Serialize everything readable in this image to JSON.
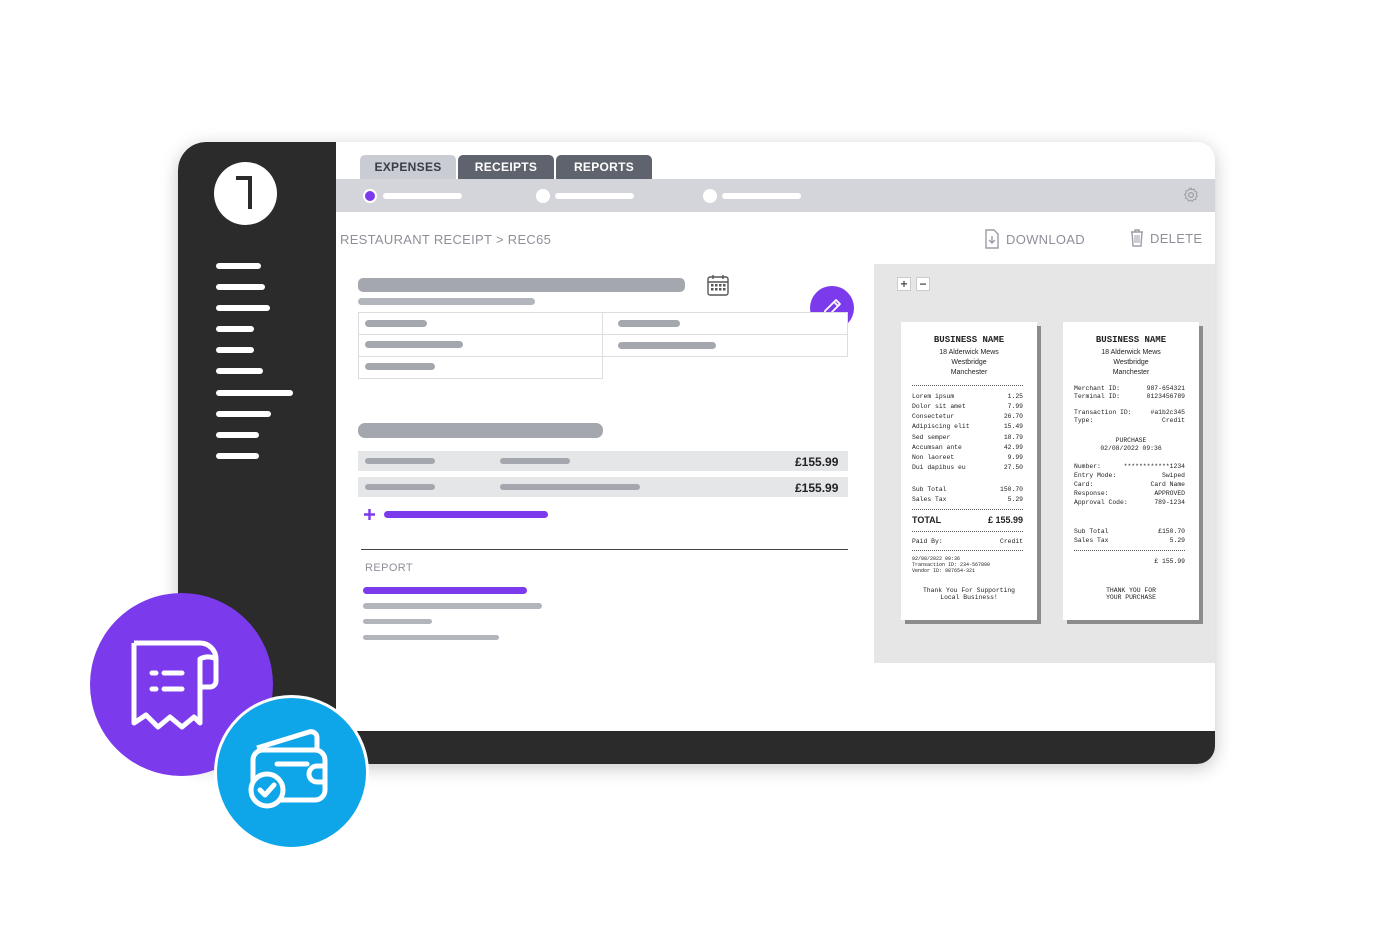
{
  "tabs": [
    {
      "label": "EXPENSES",
      "active": true
    },
    {
      "label": "RECEIPTS",
      "active": false
    },
    {
      "label": "REPORTS",
      "active": false
    }
  ],
  "breadcrumb": "RESTAURANT RECEIPT > REC65",
  "actions": {
    "download": "DOWNLOAD",
    "delete": "DELETE"
  },
  "line_items": [
    {
      "amount": "£155.99"
    },
    {
      "amount": "£155.99"
    }
  ],
  "report": {
    "label": "REPORT"
  },
  "colors": {
    "accent": "#7c3aed",
    "secondary": "#0ea5e9",
    "dark": "#2b2b2b"
  },
  "icons": [
    "calendar-icon",
    "pencil-icon",
    "download-icon",
    "trash-icon",
    "gear-icon",
    "plus-icon",
    "minus-icon",
    "receipt-icon",
    "wallet-icon"
  ],
  "receipt_left": {
    "title": "BUSINESS NAME",
    "address": [
      "18 Alderwick Mews",
      "Westbridge",
      "Manchester"
    ],
    "items": [
      {
        "name": "Lorem ipsum",
        "price": "1.25"
      },
      {
        "name": "Dolor sit amet",
        "price": "7.99"
      },
      {
        "name": "Consectetur",
        "price": "26.70"
      },
      {
        "name": "Adipiscing elit",
        "price": "15.49"
      },
      {
        "name": "Sed semper",
        "price": "18.79"
      },
      {
        "name": "Accumsan ante",
        "price": "42.99"
      },
      {
        "name": "Non laoreet",
        "price": "9.99"
      },
      {
        "name": "Dui dapibus eu",
        "price": "27.50"
      }
    ],
    "subtotal_label": "Sub Total",
    "subtotal": "150.70",
    "tax_label": "Sales Tax",
    "tax": "5.29",
    "total_label": "TOTAL",
    "total": "£ 155.99",
    "paid_label": "Paid By:",
    "paid": "Credit",
    "meta": [
      "02/08/2022 09:36",
      "Transaction ID: 234-567890",
      "Vendor ID: 987654-321"
    ],
    "footer": [
      "Thank You For Supporting",
      "Local Business!"
    ]
  },
  "receipt_right": {
    "title": "BUSINESS NAME",
    "address": [
      "18 Alderwick Mews",
      "Westbridge",
      "Manchester"
    ],
    "merchant_label": "Merchant ID:",
    "merchant": "987-654321",
    "terminal_label": "Terminal ID:",
    "terminal": "0123456789",
    "txn_label": "Transaction ID:",
    "txn": "#a1b2c345",
    "type_label": "Type:",
    "type": "Credit",
    "purchase": "PURCHASE",
    "purchase_date": "02/08/2022 09:36",
    "number_label": "Number:",
    "number": "************1234",
    "entry_label": "Entry Mode:",
    "entry": "Swiped",
    "card_label": "Card:",
    "card": "Card Name",
    "response_label": "Response:",
    "response": "APPROVED",
    "approval_label": "Approval Code:",
    "approval": "789-1234",
    "subtotal_label": "Sub Total",
    "subtotal": "£150.70",
    "tax_label": "Sales Tax",
    "tax": "5.29",
    "total": "£ 155.99",
    "footer": [
      "THANK YOU FOR",
      "YOUR PURCHASE"
    ]
  }
}
